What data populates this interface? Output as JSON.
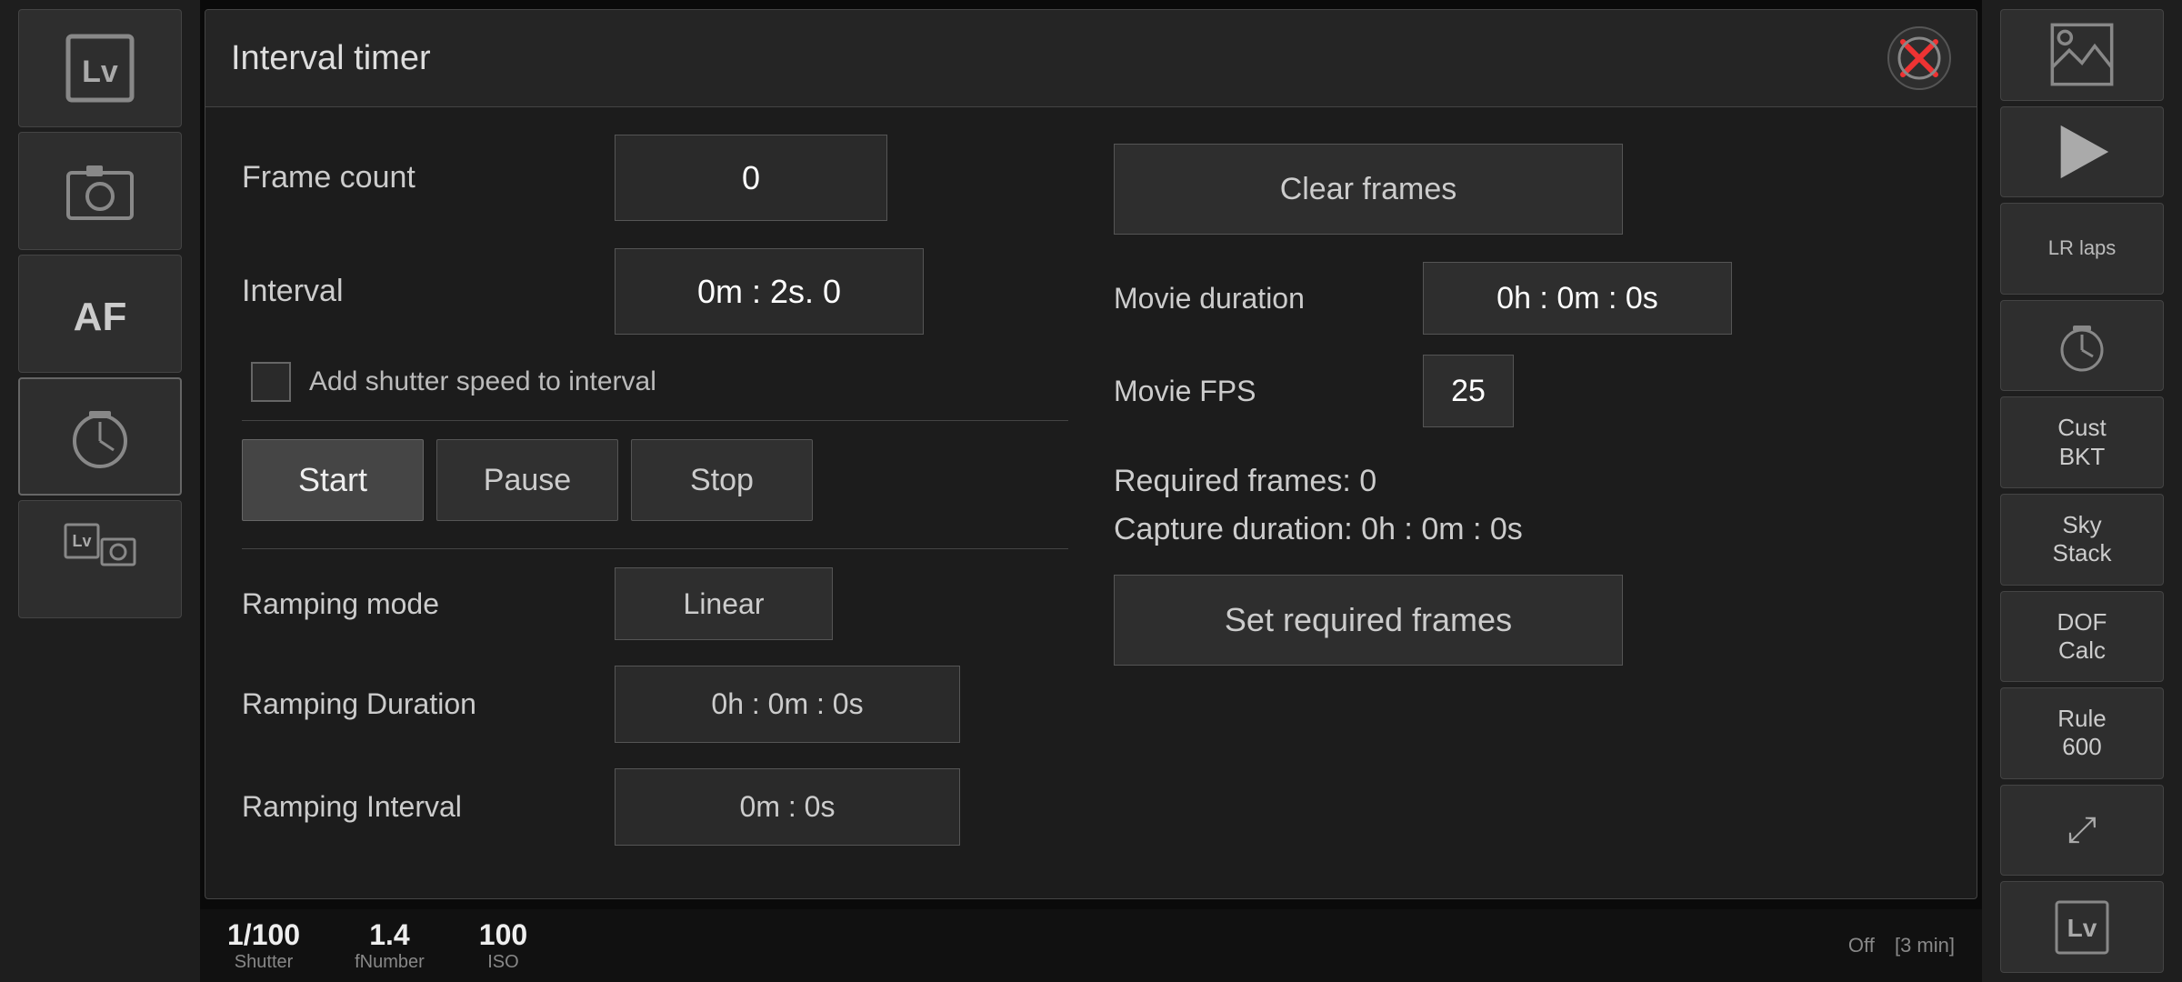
{
  "dialog": {
    "title": "Interval timer",
    "close_label": "×"
  },
  "frame_count": {
    "label": "Frame count",
    "value": "0"
  },
  "clear_frames": {
    "label": "Clear frames"
  },
  "interval": {
    "label": "Interval",
    "value": "0m : 2s. 0"
  },
  "movie_duration": {
    "label": "Movie duration",
    "value": "0h : 0m : 0s"
  },
  "add_shutter": {
    "label": "Add shutter speed to interval"
  },
  "movie_fps": {
    "label": "Movie FPS",
    "value": "25"
  },
  "controls": {
    "start": "Start",
    "pause": "Pause",
    "stop": "Stop"
  },
  "required_frames": {
    "label": "Required frames: 0"
  },
  "capture_duration": {
    "label": "Capture duration: 0h : 0m : 0s"
  },
  "set_required_frames": {
    "label": "Set required frames"
  },
  "ramping_mode": {
    "label": "Ramping mode",
    "value": "Linear"
  },
  "ramping_duration": {
    "label": "Ramping Duration",
    "value": "0h : 0m : 0s"
  },
  "ramping_interval": {
    "label": "Ramping Interval",
    "value": "0m : 0s"
  },
  "sidebar_left": {
    "lv_label": "Lv",
    "camera_label": "📷",
    "af_label": "AF",
    "timer_label": "⏱",
    "lv_cam_label": "Lv📷"
  },
  "sidebar_right": {
    "image_label": "🖼",
    "play_label": "▶",
    "lr_label": "LR\nlaps",
    "timer_icon": "⏱",
    "cust_bkt": "Cust\nBKT",
    "sky_stack": "Sky\nStack",
    "dof_calc": "DOF\nCalc",
    "rule_600": "Rule\n600",
    "expand": "⤢",
    "lv2_label": "Lv"
  },
  "bottom_bar": {
    "shutter_value": "1/100",
    "shutter_label": "Shutter",
    "fnumber_value": "1.4",
    "fnumber_label": "fNumber",
    "iso_value": "100",
    "iso_label": "ISO",
    "status": "Off",
    "timer_status": "[3 min]"
  }
}
